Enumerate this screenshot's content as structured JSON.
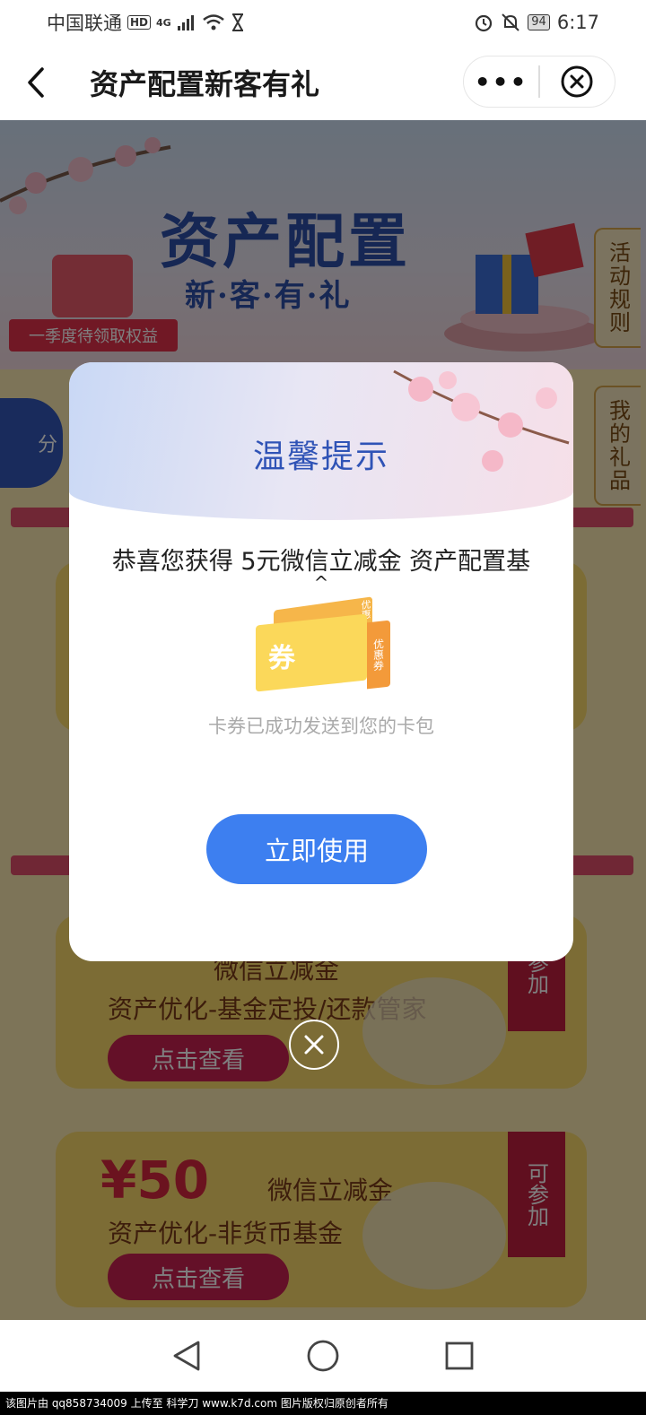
{
  "status_bar": {
    "carrier": "中国联通",
    "hd": "HD",
    "network": "4G",
    "battery": "94",
    "time": "6:17"
  },
  "nav": {
    "title": "资产配置新客有礼",
    "more": "•••"
  },
  "banner": {
    "title": "资产配置",
    "subtitle": "新·客·有·礼",
    "ribbon": "一季度待领取权益",
    "side_rule": "活动规则",
    "side_gift": "我的礼品",
    "left_cut": "分"
  },
  "cards": [
    {
      "amount": "",
      "amount_desc": "微信立减金",
      "title": "资产优化-基金定投/还款管家",
      "button": "点击查看",
      "flag": "参加"
    },
    {
      "amount": "¥50",
      "amount_desc": "微信立减金",
      "title": "资产优化-非货币基金",
      "button": "点击查看",
      "flag": "可参加"
    }
  ],
  "modal": {
    "title": "温馨提示",
    "message": "恭喜您获得 5元微信立减金 资产配置基",
    "caret": "^",
    "coupon_main": "券",
    "coupon_side_top": "优惠",
    "coupon_side": "优惠券",
    "hint": "卡券已成功发送到您的卡包",
    "use_button": "立即使用"
  },
  "watermark": "该图片由 qq858734009 上传至 科学刀 www.k7d.com 图片版权归原创者所有",
  "colors": {
    "primary_blue": "#3d7ff0",
    "title_blue": "#2f53b6",
    "card_yellow": "#f8d86a",
    "accent_red": "#c92050"
  }
}
